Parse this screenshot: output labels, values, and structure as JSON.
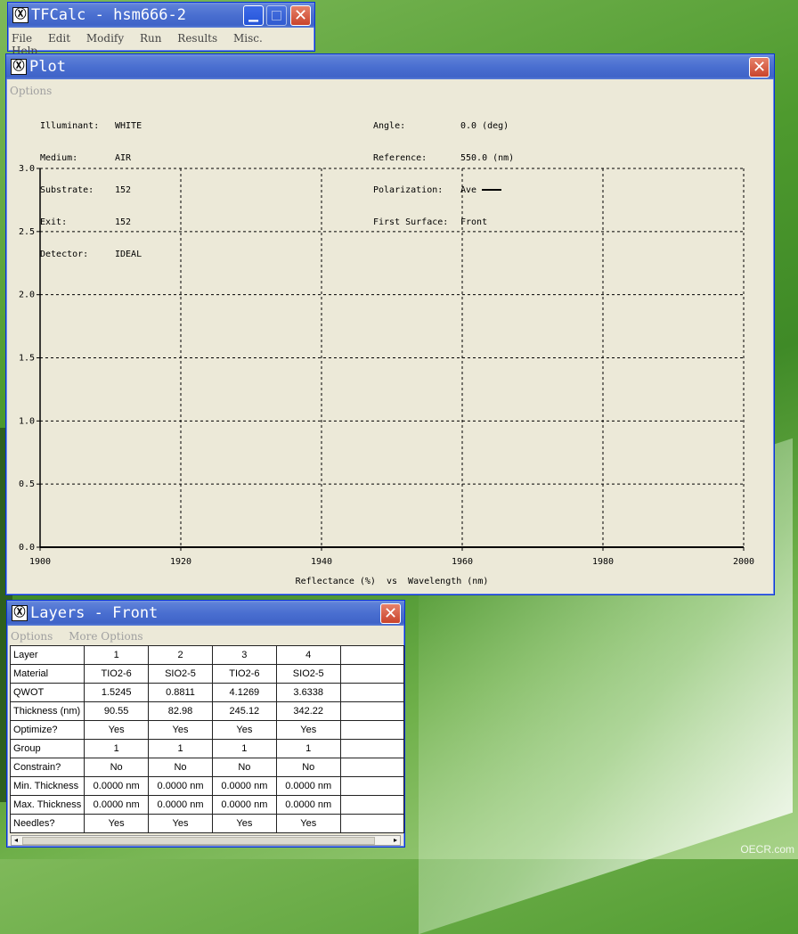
{
  "main_window": {
    "title": "TFCalc - hsm666-2",
    "menu": [
      "File",
      "Edit",
      "Modify",
      "Run",
      "Results",
      "Misc.",
      "Help"
    ]
  },
  "plot_window": {
    "title": "Plot",
    "menu": [
      "Options"
    ],
    "info_left": [
      {
        "label": "Illuminant:",
        "value": "WHITE"
      },
      {
        "label": "Medium:",
        "value": "AIR"
      },
      {
        "label": "Substrate:",
        "value": "152"
      },
      {
        "label": "Exit:",
        "value": "152"
      },
      {
        "label": "Detector:",
        "value": "IDEAL"
      }
    ],
    "info_right": [
      {
        "label": "Angle:",
        "value": "0.0 (deg)"
      },
      {
        "label": "Reference:",
        "value": "550.0 (nm)"
      },
      {
        "label": "Polarization:",
        "value": "Ave"
      },
      {
        "label": "First Surface:",
        "value": "Front"
      }
    ]
  },
  "chart_data": {
    "type": "line",
    "title": "",
    "xlabel": "Reflectance (%)  vs  Wavelength (nm)",
    "ylabel": "",
    "xlim": [
      1900,
      2000
    ],
    "ylim": [
      0.0,
      3.0
    ],
    "x_ticks": [
      "1900",
      "1920",
      "1940",
      "1960",
      "1980",
      "2000"
    ],
    "y_ticks": [
      "3.0",
      "2.5",
      "2.0",
      "1.5",
      "1.0",
      "0.5",
      "0.0"
    ],
    "grid": true,
    "grid_style": "dashed",
    "series": [
      {
        "x": [
          1900,
          1920,
          1940,
          1960,
          1980,
          2000
        ],
        "values": [
          0.0,
          0.0,
          0.0,
          0.0,
          0.0,
          0.0
        ],
        "color": "#000000"
      }
    ]
  },
  "layers_window": {
    "title": "Layers - Front",
    "menu": [
      "Options",
      "More Options"
    ],
    "rows": [
      {
        "label": "Layer",
        "cells": [
          "1",
          "2",
          "3",
          "4",
          ""
        ]
      },
      {
        "label": "Material",
        "cells": [
          "TIO2-6",
          "SIO2-5",
          "TIO2-6",
          "SIO2-5",
          ""
        ]
      },
      {
        "label": "QWOT",
        "cells": [
          "1.5245",
          "0.8811",
          "4.1269",
          "3.6338",
          ""
        ]
      },
      {
        "label": "Thickness (nm)",
        "cells": [
          "90.55",
          "82.98",
          "245.12",
          "342.22",
          ""
        ]
      },
      {
        "label": "Optimize?",
        "cells": [
          "Yes",
          "Yes",
          "Yes",
          "Yes",
          ""
        ]
      },
      {
        "label": "Group",
        "cells": [
          "1",
          "1",
          "1",
          "1",
          ""
        ]
      },
      {
        "label": "Constrain?",
        "cells": [
          "No",
          "No",
          "No",
          "No",
          ""
        ]
      },
      {
        "label": "Min. Thickness",
        "cells": [
          "0.0000 nm",
          "0.0000 nm",
          "0.0000 nm",
          "0.0000 nm",
          ""
        ]
      },
      {
        "label": "Max. Thickness",
        "cells": [
          "0.0000 nm",
          "0.0000 nm",
          "0.0000 nm",
          "0.0000 nm",
          ""
        ]
      },
      {
        "label": "Needles?",
        "cells": [
          "Yes",
          "Yes",
          "Yes",
          "Yes",
          ""
        ]
      }
    ]
  },
  "watermark": "OECR.com",
  "colors": {
    "titlebar": "#4a6fd0",
    "window_bg": "#ece9d8",
    "close_button": "#c9432b"
  }
}
